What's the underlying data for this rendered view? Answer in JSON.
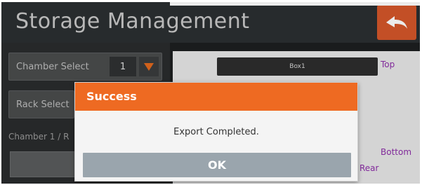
{
  "header": {
    "title": "Storage Management",
    "back_icon": "back-arrow-icon"
  },
  "left_panel": {
    "chamber_select_label": "Chamber Select",
    "chamber_value": "1",
    "dropdown_icon": "triangle-down-icon",
    "rack_select_label": "Rack Select",
    "path_text": "Chamber 1 / R"
  },
  "right_panel": {
    "box_label": "Box1",
    "top_label": "Top",
    "bottom_label": "Bottom",
    "rear_label": "Rear"
  },
  "dialog": {
    "title": "Success",
    "message": "Export Completed.",
    "ok_label": "OK"
  },
  "colors": {
    "accent_orange": "#ee6a22",
    "back_button": "#d4562a",
    "label_purple": "#8d2ea8",
    "ok_button": "#9aa5ad"
  }
}
